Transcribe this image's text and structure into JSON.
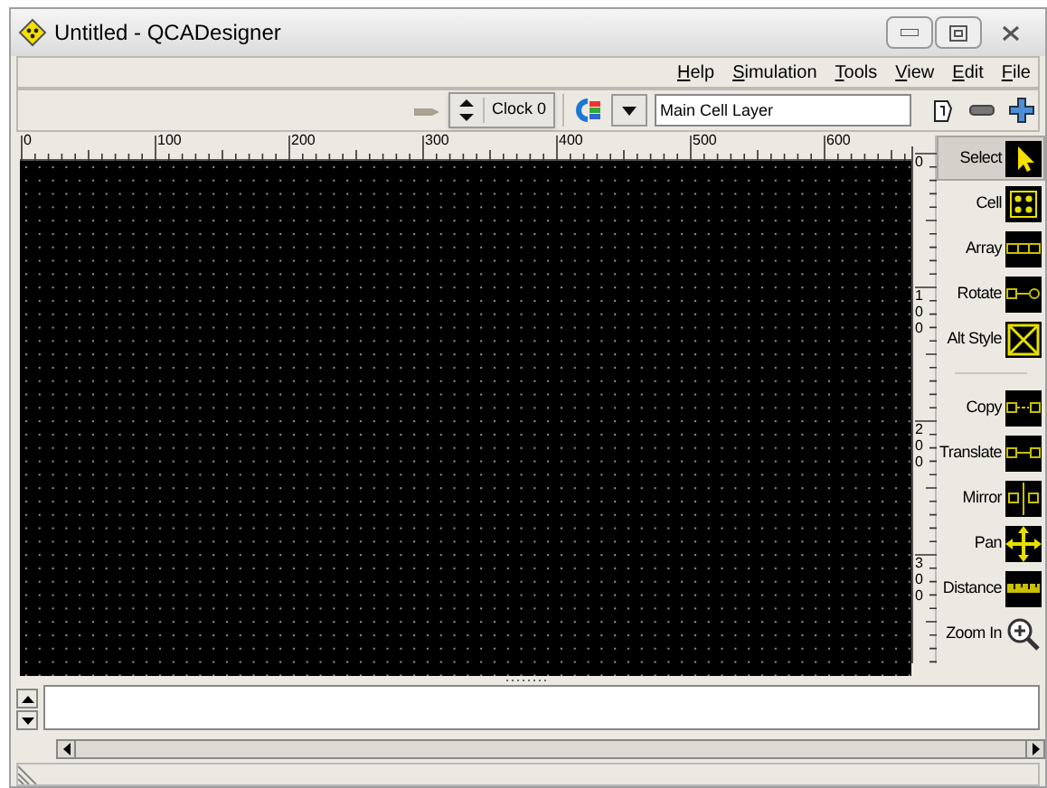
{
  "window": {
    "title": "Untitled - QCADesigner"
  },
  "menu": [
    {
      "label": "Help"
    },
    {
      "label": "Simulation"
    },
    {
      "label": "Tools"
    },
    {
      "label": "View"
    },
    {
      "label": "Edit"
    },
    {
      "label": "File"
    }
  ],
  "toolbar": {
    "clock": "Clock 0",
    "layer": "Main Cell Layer"
  },
  "ruler_horizontal": [
    "0",
    "100",
    "200",
    "300",
    "400",
    "500",
    "600"
  ],
  "ruler_vertical": [
    "0",
    "100",
    "200",
    "300"
  ],
  "tools": [
    {
      "kind": "select",
      "label": "Select",
      "selected": true
    },
    {
      "kind": "cell",
      "label": "Cell",
      "selected": false
    },
    {
      "kind": "array",
      "label": "Array",
      "selected": false
    },
    {
      "kind": "rotate",
      "label": "Rotate",
      "selected": false
    },
    {
      "kind": "style",
      "label": "Alt Style",
      "selected": false
    },
    {
      "kind": "separator"
    },
    {
      "kind": "copy",
      "label": "Copy",
      "selected": false
    },
    {
      "kind": "translate",
      "label": "Translate",
      "selected": false
    },
    {
      "kind": "mirror",
      "label": "Mirror",
      "selected": false
    },
    {
      "kind": "pan",
      "label": "Pan",
      "selected": false
    },
    {
      "kind": "distance",
      "label": "Distance",
      "selected": false
    },
    {
      "kind": "zoom",
      "label": "Zoom In",
      "selected": false
    }
  ]
}
